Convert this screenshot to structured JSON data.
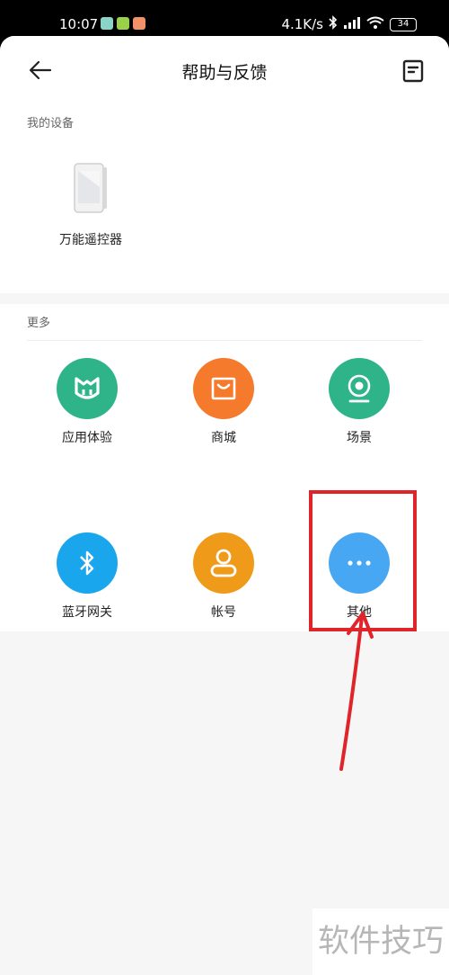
{
  "status_bar": {
    "time": "10:07",
    "network_speed": "4.1K/s",
    "battery": "34"
  },
  "header": {
    "title": "帮助与反馈",
    "back_icon": "arrow-left-icon",
    "feedback_icon": "feedback-list-icon"
  },
  "my_devices": {
    "label": "我的设备",
    "items": [
      {
        "label": "万能遥控器",
        "icon": "phone-device-icon"
      }
    ]
  },
  "more": {
    "label": "更多",
    "items": [
      {
        "label": "应用体验",
        "icon": "mi-logo-icon",
        "color": "#2fb48a"
      },
      {
        "label": "商城",
        "icon": "shopping-bag-icon",
        "color": "#f57a2b"
      },
      {
        "label": "场景",
        "icon": "camera-scene-icon",
        "color": "#2fb48a"
      },
      {
        "label": "蓝牙网关",
        "icon": "bluetooth-icon",
        "color": "#1aa6ec"
      },
      {
        "label": "帐号",
        "icon": "account-icon",
        "color": "#f09a1a"
      },
      {
        "label": "其他",
        "icon": "more-dots-icon",
        "color": "#47a7f3"
      }
    ]
  },
  "annotation": {
    "highlight_color": "#e0252a"
  },
  "watermark": "软件技巧"
}
